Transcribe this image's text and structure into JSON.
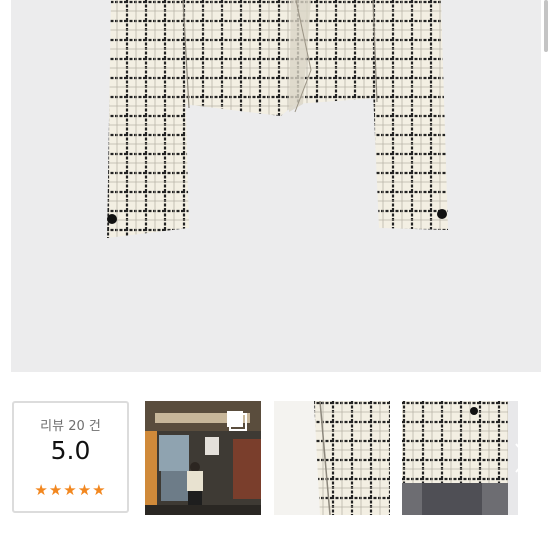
{
  "review": {
    "count_label": "리뷰 20 건",
    "score": "5.0",
    "stars": "★★★★★"
  },
  "thumbnails": [
    {
      "name": "review-photo-1"
    },
    {
      "name": "review-photo-2"
    },
    {
      "name": "review-photo-3"
    },
    {
      "name": "review-photo-4"
    }
  ],
  "colors": {
    "star": "#f2871f",
    "tweed_base": "#f3efe3",
    "tweed_check": "#1c1c1c",
    "image_bg": "#ececed"
  },
  "icons": [
    "chevron-right-icon",
    "multi-image-icon",
    "star-icon"
  ]
}
